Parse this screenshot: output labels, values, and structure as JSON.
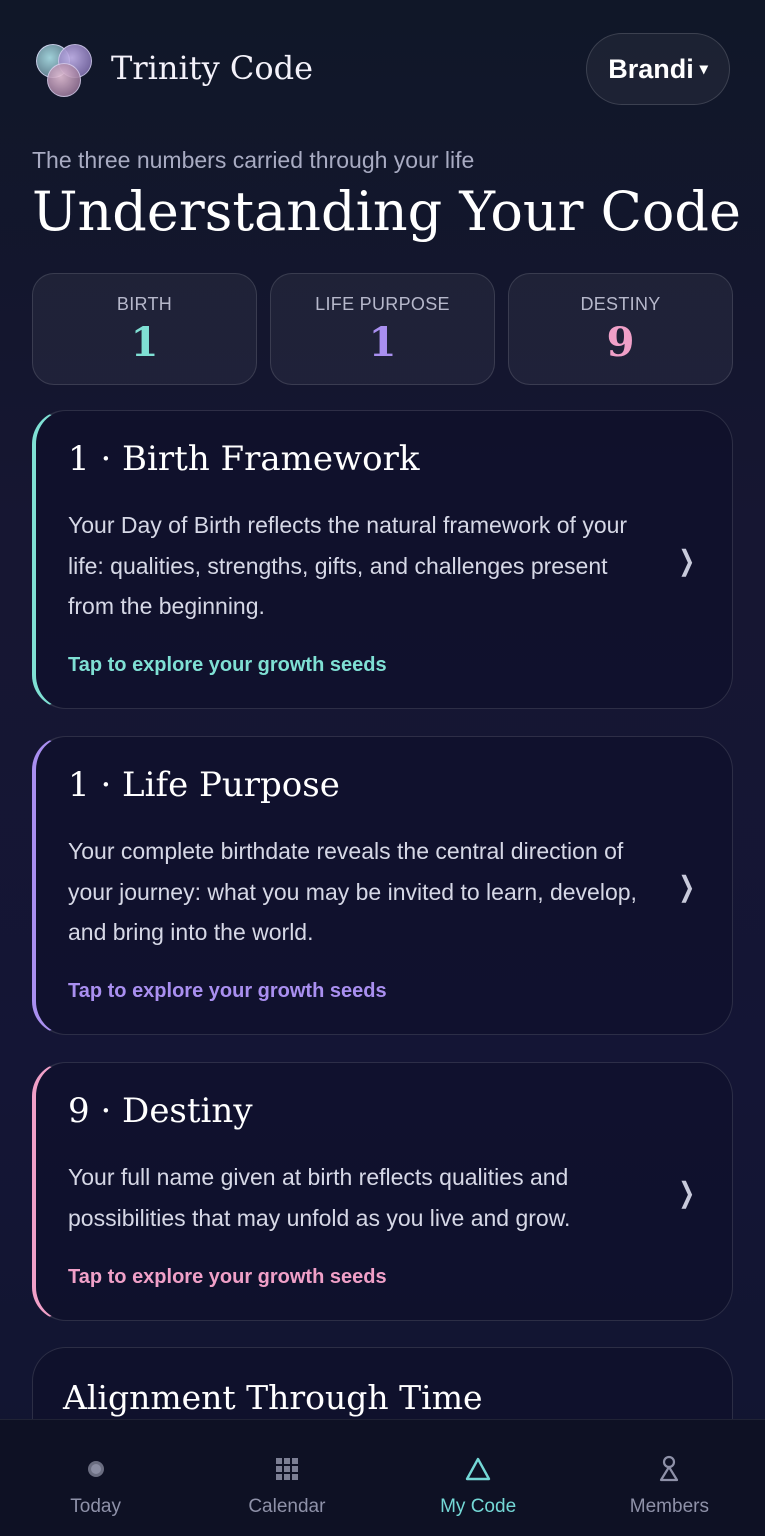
{
  "header": {
    "app_title": "Trinity Code",
    "user_name": "Brandi",
    "user_caret": "▾"
  },
  "intro": {
    "subtitle": "The three numbers carried through your life",
    "title": "Understanding Your Code"
  },
  "numbers": [
    {
      "label": "BIRTH",
      "value": "1",
      "color": "#7fe0d4"
    },
    {
      "label": "LIFE PURPOSE",
      "value": "1",
      "color": "#a98ff0"
    },
    {
      "label": "DESTINY",
      "value": "9",
      "color": "#f0a0c8"
    }
  ],
  "cards": [
    {
      "title": "1 · Birth Framework",
      "body": "Your Day of Birth reflects the natural framework of your life: qualities, strengths, gifts, and challenges present from the beginning.",
      "cta": "Tap to explore your growth seeds",
      "accent": "#7fe0d4",
      "chevron": "❯"
    },
    {
      "title": "1 · Life Purpose",
      "body": "Your complete birthdate reveals the central direction of your journey: what you may be invited to learn, develop, and bring into the world.",
      "cta": "Tap to explore your growth seeds",
      "accent": "#a98ff0",
      "chevron": "❯"
    },
    {
      "title": "9 · Destiny",
      "body": "Your full name given at birth reflects qualities and possibilities that may unfold as you live and grow.",
      "cta": "Tap to explore your growth seeds",
      "accent": "#f0a0c8",
      "chevron": "❯"
    }
  ],
  "partial_card": {
    "title": "Alignment Through Time"
  },
  "nav": {
    "items": [
      {
        "label": "Today",
        "icon": "dot-icon"
      },
      {
        "label": "Calendar",
        "icon": "calendar-grid-icon"
      },
      {
        "label": "My Code",
        "icon": "triangle-icon"
      },
      {
        "label": "Members",
        "icon": "person-icon"
      }
    ],
    "active": "My Code",
    "active_color": "#74d8d6"
  }
}
